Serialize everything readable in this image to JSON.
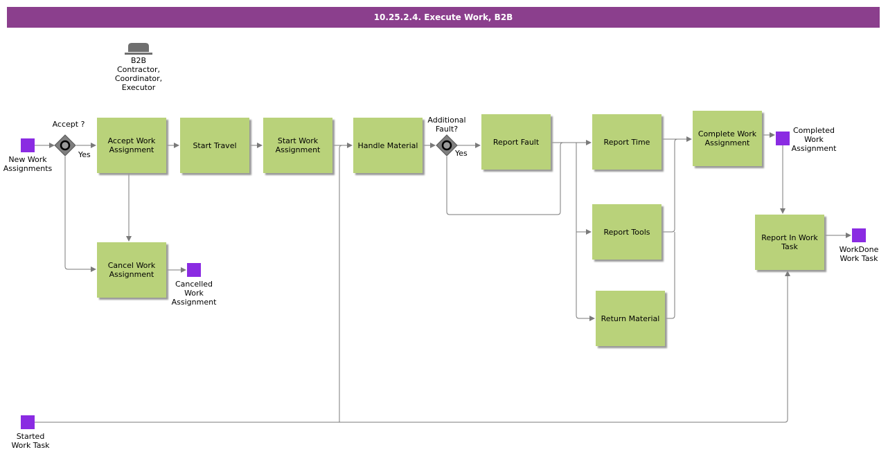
{
  "title": "10.25.2.4. Execute Work, B2B",
  "role": {
    "icon": "role-icon",
    "lines": [
      "B2B",
      "Contractor,",
      "Coordinator,",
      "Executor"
    ]
  },
  "gateways": {
    "accept": {
      "label": "Accept ?",
      "yes": "Yes"
    },
    "fault": {
      "label_lines": [
        "Additional",
        "Fault?"
      ],
      "yes": "Yes"
    }
  },
  "tasks": {
    "accept_work": [
      "Accept Work",
      "Assignment"
    ],
    "start_travel": [
      "Start Travel"
    ],
    "start_work": [
      "Start Work",
      "Assignment"
    ],
    "handle_material": [
      "Handle Material"
    ],
    "report_fault": [
      "Report Fault"
    ],
    "report_time": [
      "Report Time"
    ],
    "report_tools": [
      "Report Tools"
    ],
    "return_material": [
      "Return Material"
    ],
    "complete_work": [
      "Complete Work",
      "Assignment"
    ],
    "report_in_work": [
      "Report In Work",
      "Task"
    ],
    "cancel_work": [
      "Cancel Work",
      "Assignment"
    ]
  },
  "events": {
    "new_work": [
      "New Work",
      "Assignments"
    ],
    "cancelled": [
      "Cancelled",
      "Work",
      "Assignment"
    ],
    "completed": [
      "Completed",
      "Work",
      "Assignment"
    ],
    "workdone": [
      "WorkDone",
      "Work Task"
    ],
    "started": [
      "Started",
      "Work Task"
    ]
  },
  "colors": {
    "header": "#8b3f8d",
    "task": "#b9d27a",
    "event": "#8a2be2",
    "gateway": "#7f7f7f",
    "line": "#7a7a7a"
  }
}
